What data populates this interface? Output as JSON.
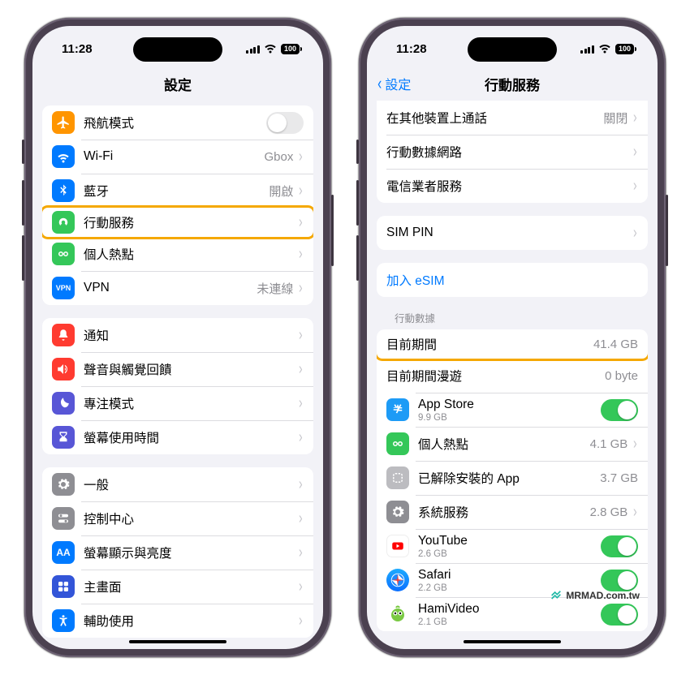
{
  "status": {
    "time": "11:28",
    "battery": "100"
  },
  "left": {
    "title": "設定",
    "g1": {
      "airplane": "飛航模式",
      "wifi": "Wi-Fi",
      "wifi_val": "Gbox",
      "bt": "藍牙",
      "bt_val": "開啟",
      "cellular": "行動服務",
      "hotspot": "個人熱點",
      "vpn": "VPN",
      "vpn_val": "未連線"
    },
    "g2": {
      "notif": "通知",
      "sound": "聲音與觸覺回饋",
      "focus": "專注模式",
      "screentime": "螢幕使用時間"
    },
    "g3": {
      "general": "一般",
      "control": "控制中心",
      "display": "螢幕顯示與亮度",
      "home": "主畫面",
      "access": "輔助使用"
    }
  },
  "right": {
    "back": "設定",
    "title": "行動服務",
    "g1": {
      "other_calls": "在其他裝置上通話",
      "other_calls_val": "關閉",
      "data_net": "行動數據網路",
      "carrier": "電信業者服務",
      "simpin": "SIM PIN"
    },
    "add_esim": "加入 eSIM",
    "data_header": "行動數據",
    "period": "目前期間",
    "period_val": "41.4 GB",
    "roaming": "目前期間漫遊",
    "roaming_val": "0 byte",
    "apps": {
      "appstore": "App Store",
      "appstore_sub": "9.9 GB",
      "hotspot": "個人熱點",
      "hotspot_val": "4.1 GB",
      "removed": "已解除安裝的 App",
      "removed_val": "3.7 GB",
      "system": "系統服務",
      "system_val": "2.8 GB",
      "youtube": "YouTube",
      "youtube_sub": "2.6 GB",
      "safari": "Safari",
      "safari_sub": "2.2 GB",
      "hami": "HamiVideo",
      "hami_sub": "2.1 GB"
    }
  },
  "watermark": "MRMAD.com.tw"
}
